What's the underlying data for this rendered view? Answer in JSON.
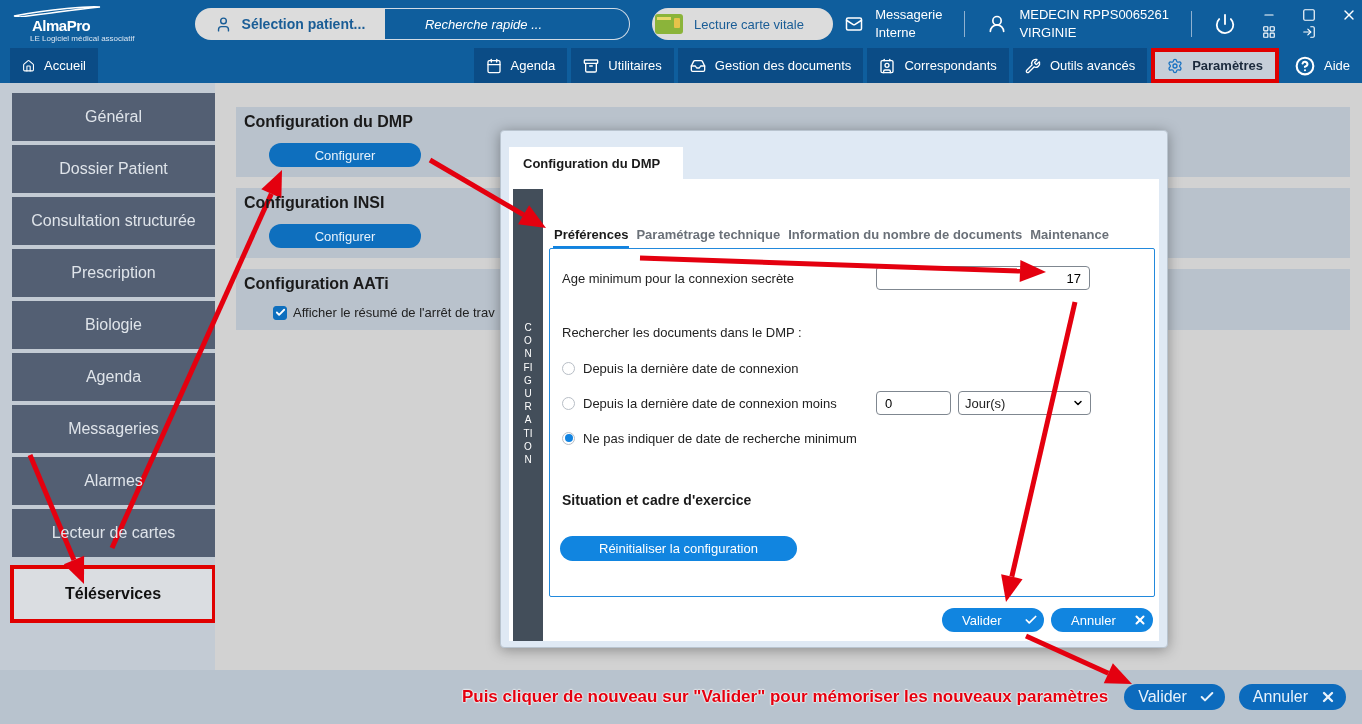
{
  "logo": {
    "name": "AlmaPro",
    "tagline": "LE Logiciel médical associatif"
  },
  "patient_search": {
    "button": "Sélection patient...",
    "placeholder": "Recherche rapide ..."
  },
  "vitale_button": "Lecture carte vitale",
  "messaging": {
    "lines": [
      "Messagerie",
      "Interne"
    ]
  },
  "user": {
    "lines": [
      "MEDECIN RPPS0065261",
      "VIRGINIE"
    ]
  },
  "home_tab": {
    "label": "Accueil",
    "selected": false
  },
  "nav_tabs": [
    {
      "label": "Agenda",
      "kind": "tab",
      "selected": false,
      "highlighted": false
    },
    {
      "label": "Utilitaires",
      "kind": "tab",
      "selected": false,
      "highlighted": false
    },
    {
      "label": "Gestion des documents",
      "kind": "tab",
      "selected": false,
      "highlighted": false
    },
    {
      "label": "Correspondants",
      "kind": "tab",
      "selected": false,
      "highlighted": false
    },
    {
      "label": "Outils avancés",
      "kind": "tab",
      "selected": false,
      "highlighted": false
    },
    {
      "label": "Paramètres",
      "kind": "tab",
      "selected": true,
      "highlighted": true
    },
    {
      "label": "Aide",
      "kind": "link",
      "selected": false,
      "highlighted": false
    }
  ],
  "sidebar": {
    "items": [
      {
        "label": "Général",
        "selected": false,
        "highlighted": false
      },
      {
        "label": "Dossier Patient",
        "selected": false,
        "highlighted": false
      },
      {
        "label": "Consultation structurée",
        "selected": false,
        "highlighted": false
      },
      {
        "label": "Prescription",
        "selected": false,
        "highlighted": false
      },
      {
        "label": "Biologie",
        "selected": false,
        "highlighted": false
      },
      {
        "label": "Agenda",
        "selected": false,
        "highlighted": false
      },
      {
        "label": "Messageries",
        "selected": false,
        "highlighted": false
      },
      {
        "label": "Alarmes",
        "selected": false,
        "highlighted": false
      },
      {
        "label": "Lecteur de cartes",
        "selected": false,
        "highlighted": false
      },
      {
        "label": "Téléservices",
        "selected": true,
        "highlighted": true
      }
    ]
  },
  "sections": [
    {
      "title": "Configuration du DMP",
      "kind": "button",
      "button": "Configurer"
    },
    {
      "title": "Configuration INSI",
      "kind": "button",
      "button": "Configurer"
    },
    {
      "title": "Configuration AATi",
      "kind": "checkbox",
      "checkbox": {
        "label": "Afficher le résumé de l'arrêt de trav",
        "checked": true
      }
    }
  ],
  "dialog": {
    "title": "Configuration du DMP",
    "side_label": "CONFIGURATION",
    "tabs": [
      {
        "label": "Préférences",
        "selected": true
      },
      {
        "label": "Paramétrage technique",
        "selected": false
      },
      {
        "label": "Information du nombre de documents",
        "selected": false
      },
      {
        "label": "Maintenance",
        "selected": false
      }
    ],
    "age_label": "Age minimum pour la connexion secrète",
    "age_value": "17",
    "search_label": "Rechercher les documents dans le DMP :",
    "radios": [
      {
        "label": "Depuis la dernière date de connexion",
        "selected": false,
        "kind": "plain"
      },
      {
        "label": "Depuis la dernière date de connexion moins",
        "selected": false,
        "kind": "amount",
        "amount": "0",
        "unit": "Jour(s)"
      },
      {
        "label": "Ne pas indiquer de date de recherche minimum",
        "selected": true,
        "kind": "plain"
      }
    ],
    "section_title": "Situation et cadre d'exercice",
    "reset_button": "Réinitialiser la configuration",
    "buttons": [
      {
        "label": "Valider",
        "kind": "confirm"
      },
      {
        "label": "Annuler",
        "kind": "cancel"
      }
    ]
  },
  "footer": {
    "instruction": "Puis cliquer de nouveau sur \"Valider\" pour mémoriser les nouveaux paramètres",
    "buttons": [
      {
        "label": "Valider",
        "kind": "confirm"
      },
      {
        "label": "Annuler",
        "kind": "cancel"
      }
    ]
  }
}
